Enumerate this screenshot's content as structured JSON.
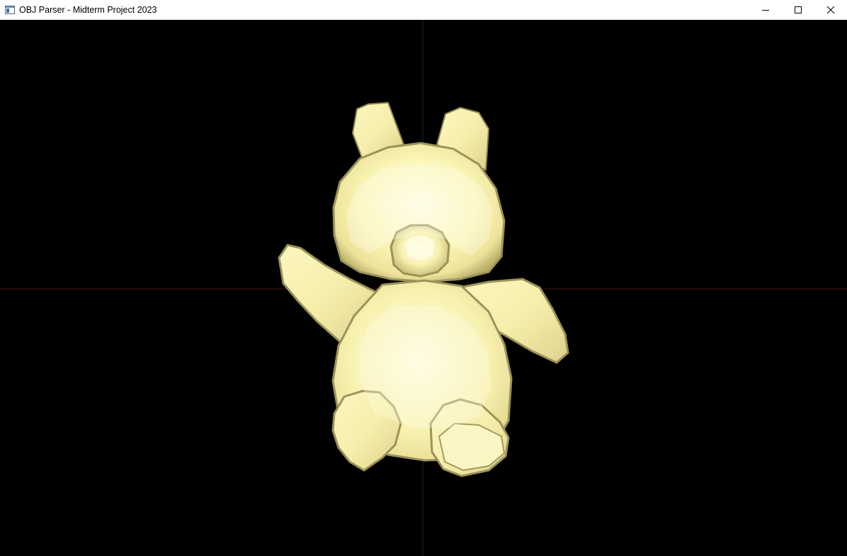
{
  "window": {
    "title": "OBJ Parser - Midterm Project 2023",
    "app_icon": "window-app-icon",
    "buttons": [
      {
        "name": "minimize-button",
        "icon": "minimize-icon"
      },
      {
        "name": "maximize-button",
        "icon": "maximize-icon"
      },
      {
        "name": "close-button",
        "icon": "close-icon"
      }
    ]
  },
  "viewport": {
    "background_color": "#000000",
    "x_axis_color": "#5a1414",
    "y_axis_color": "#143a14",
    "model": {
      "name": "teddy-bear-model",
      "fill_color": "#fbf7b8",
      "highlight_color": "#fffde6",
      "shade_color": "#c9c07a",
      "edge_color": "#8f8850"
    }
  }
}
